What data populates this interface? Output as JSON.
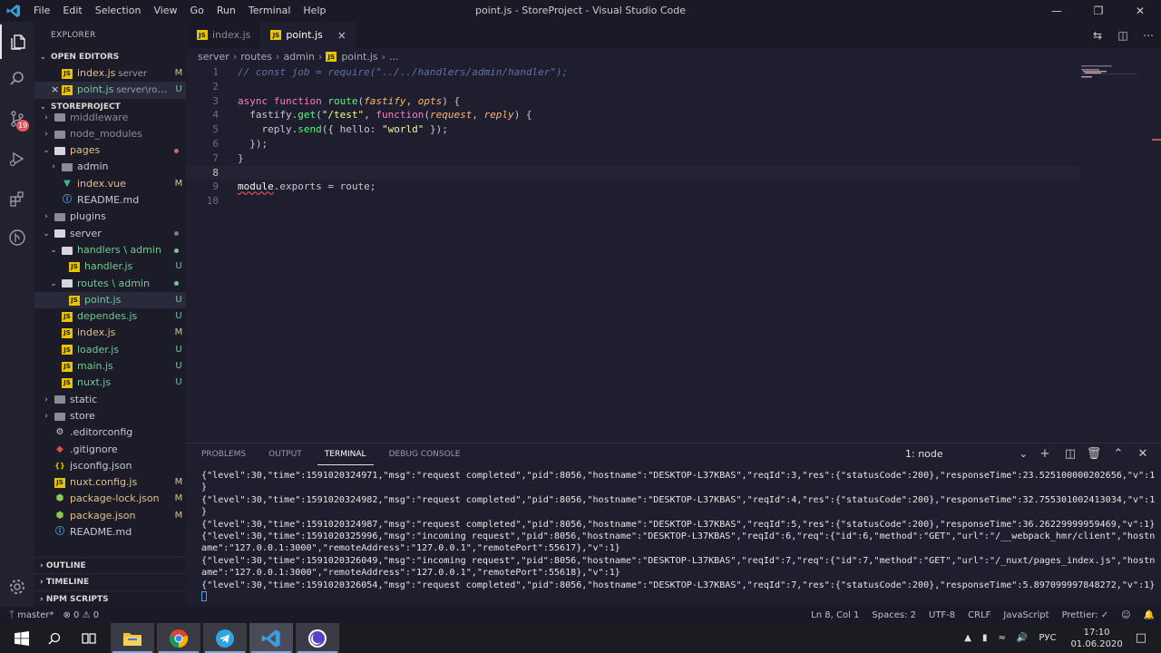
{
  "window": {
    "title": "point.js - StoreProject - Visual Studio Code",
    "menu": [
      "File",
      "Edit",
      "Selection",
      "View",
      "Go",
      "Run",
      "Terminal",
      "Help"
    ],
    "controls": [
      "minimize-icon",
      "restore-icon",
      "close-icon"
    ]
  },
  "activity_bar": {
    "items": [
      "files-icon",
      "search-icon",
      "source-control-icon",
      "run-debug-icon",
      "extensions-icon",
      "git-graph-icon"
    ],
    "source_control_badge": "19",
    "settings_icon": "gear-icon"
  },
  "sidebar": {
    "title": "EXPLORER",
    "open_editors": {
      "label": "OPEN EDITORS",
      "items": [
        {
          "name": "index.js",
          "path": "server",
          "status": "M",
          "close": ""
        },
        {
          "name": "point.js",
          "path": "server\\rou...",
          "status": "U",
          "close": "×"
        }
      ]
    },
    "project": {
      "label": "STOREPROJECT",
      "tree": [
        {
          "name": "middleware",
          "icon": "folder",
          "depth": 1,
          "arrow": "›",
          "status": "",
          "color": "dim"
        },
        {
          "name": "node_modules",
          "icon": "folder",
          "depth": 1,
          "arrow": "›",
          "status": "",
          "color": "dim"
        },
        {
          "name": "pages",
          "icon": "folder-open",
          "depth": 1,
          "arrow": "⌄",
          "status": "dot-mod",
          "color": "mod"
        },
        {
          "name": "admin",
          "icon": "folder",
          "depth": 2,
          "arrow": "›",
          "status": "",
          "color": "plain"
        },
        {
          "name": "index.vue",
          "icon": "vue",
          "depth": 2,
          "arrow": "",
          "status": "M",
          "color": "mod"
        },
        {
          "name": "README.md",
          "icon": "info",
          "depth": 2,
          "arrow": "",
          "status": "",
          "color": "plain"
        },
        {
          "name": "plugins",
          "icon": "folder",
          "depth": 1,
          "arrow": "›",
          "status": "",
          "color": "plain"
        },
        {
          "name": "server",
          "icon": "folder-open",
          "depth": 1,
          "arrow": "⌄",
          "status": "dot-grey",
          "color": "plain"
        },
        {
          "name": "handlers \\ admin",
          "icon": "folder-open",
          "depth": 2,
          "arrow": "⌄",
          "status": "dot-new",
          "color": "new"
        },
        {
          "name": "handler.js",
          "icon": "js",
          "depth": 3,
          "arrow": "",
          "status": "U",
          "color": "new"
        },
        {
          "name": "routes \\ admin",
          "icon": "folder-open",
          "depth": 2,
          "arrow": "⌄",
          "status": "dot-new",
          "color": "new"
        },
        {
          "name": "point.js",
          "icon": "js",
          "depth": 3,
          "arrow": "",
          "status": "U",
          "color": "new",
          "selected": true
        },
        {
          "name": "dependes.js",
          "icon": "js",
          "depth": 2,
          "arrow": "",
          "status": "U",
          "color": "new"
        },
        {
          "name": "index.js",
          "icon": "js",
          "depth": 2,
          "arrow": "",
          "status": "M",
          "color": "mod"
        },
        {
          "name": "loader.js",
          "icon": "js",
          "depth": 2,
          "arrow": "",
          "status": "U",
          "color": "new"
        },
        {
          "name": "main.js",
          "icon": "js",
          "depth": 2,
          "arrow": "",
          "status": "U",
          "color": "new"
        },
        {
          "name": "nuxt.js",
          "icon": "js",
          "depth": 2,
          "arrow": "",
          "status": "U",
          "color": "new"
        },
        {
          "name": "static",
          "icon": "folder",
          "depth": 1,
          "arrow": "›",
          "status": "",
          "color": "plain"
        },
        {
          "name": "store",
          "icon": "folder",
          "depth": 1,
          "arrow": "›",
          "status": "",
          "color": "plain"
        },
        {
          "name": ".editorconfig",
          "icon": "gear",
          "depth": 1,
          "arrow": "",
          "status": "",
          "color": "plain"
        },
        {
          "name": ".gitignore",
          "icon": "git",
          "depth": 1,
          "arrow": "",
          "status": "",
          "color": "plain"
        },
        {
          "name": "jsconfig.json",
          "icon": "json",
          "depth": 1,
          "arrow": "",
          "status": "",
          "color": "plain"
        },
        {
          "name": "nuxt.config.js",
          "icon": "js",
          "depth": 1,
          "arrow": "",
          "status": "M",
          "color": "mod"
        },
        {
          "name": "package-lock.json",
          "icon": "node",
          "depth": 1,
          "arrow": "",
          "status": "M",
          "color": "mod"
        },
        {
          "name": "package.json",
          "icon": "node",
          "depth": 1,
          "arrow": "",
          "status": "M",
          "color": "mod"
        },
        {
          "name": "README.md",
          "icon": "info",
          "depth": 1,
          "arrow": "",
          "status": "",
          "color": "plain"
        }
      ]
    },
    "outline": "OUTLINE",
    "timeline": "TIMELINE",
    "npm_scripts": "NPM SCRIPTS"
  },
  "editor": {
    "tabs": [
      {
        "label": "index.js",
        "active": false
      },
      {
        "label": "point.js",
        "active": true,
        "close": "×"
      }
    ],
    "breadcrumb": [
      "server",
      "routes",
      "admin",
      "point.js",
      "..."
    ],
    "lines": [
      {
        "n": "1",
        "text": "// const job = require(\"../../handlers/admin/handler\");"
      },
      {
        "n": "2",
        "text": ""
      },
      {
        "n": "3",
        "text": "async function route(fastify, opts) {"
      },
      {
        "n": "4",
        "text": "  fastify.get(\"/test\", function(request, reply) {"
      },
      {
        "n": "5",
        "text": "    reply.send({ hello: \"world\" });"
      },
      {
        "n": "6",
        "text": "  });"
      },
      {
        "n": "7",
        "text": "}"
      },
      {
        "n": "8",
        "text": ""
      },
      {
        "n": "9",
        "text": "module.exports = route;"
      },
      {
        "n": "10",
        "text": ""
      }
    ]
  },
  "panel": {
    "tabs": [
      "PROBLEMS",
      "OUTPUT",
      "TERMINAL",
      "DEBUG CONSOLE"
    ],
    "active_tab": "TERMINAL",
    "terminal_select": "1: node",
    "terminal_lines": [
      "{\"level\":30,\"time\":1591020324971,\"msg\":\"request completed\",\"pid\":8056,\"hostname\":\"DESKTOP-L37KBAS\",\"reqId\":3,\"res\":{\"statusCode\":200},\"responseTime\":23.525100000202656,\"v\":1",
      "}",
      "{\"level\":30,\"time\":1591020324982,\"msg\":\"request completed\",\"pid\":8056,\"hostname\":\"DESKTOP-L37KBAS\",\"reqId\":4,\"res\":{\"statusCode\":200},\"responseTime\":32.755301002413034,\"v\":1",
      "}",
      "{\"level\":30,\"time\":1591020324987,\"msg\":\"request completed\",\"pid\":8056,\"hostname\":\"DESKTOP-L37KBAS\",\"reqId\":5,\"res\":{\"statusCode\":200},\"responseTime\":36.26229999959469,\"v\":1}",
      "{\"level\":30,\"time\":1591020325996,\"msg\":\"incoming request\",\"pid\":8056,\"hostname\":\"DESKTOP-L37KBAS\",\"reqId\":6,\"req\":{\"id\":6,\"method\":\"GET\",\"url\":\"/__webpack_hmr/client\",\"hostn",
      "ame\":\"127.0.0.1:3000\",\"remoteAddress\":\"127.0.0.1\",\"remotePort\":55617},\"v\":1}",
      "{\"level\":30,\"time\":1591020326049,\"msg\":\"incoming request\",\"pid\":8056,\"hostname\":\"DESKTOP-L37KBAS\",\"reqId\":7,\"req\":{\"id\":7,\"method\":\"GET\",\"url\":\"/_nuxt/pages_index.js\",\"hostn",
      "ame\":\"127.0.0.1:3000\",\"remoteAddress\":\"127.0.0.1\",\"remotePort\":55618},\"v\":1}",
      "{\"level\":30,\"time\":1591020326054,\"msg\":\"request completed\",\"pid\":8056,\"hostname\":\"DESKTOP-L37KBAS\",\"reqId\":7,\"res\":{\"statusCode\":200},\"responseTime\":5.897099997848272,\"v\":1}"
    ]
  },
  "status_bar": {
    "branch": "master*",
    "errors": "0",
    "warnings": "0",
    "position": "Ln 8, Col 1",
    "spaces": "Spaces: 2",
    "encoding": "UTF-8",
    "eol": "CRLF",
    "language": "JavaScript",
    "prettier": "Prettier: ✓"
  },
  "taskbar": {
    "apps": [
      "windows-start-icon",
      "search-icon",
      "task-view-icon",
      "file-explorer-icon",
      "chrome-icon",
      "telegram-icon",
      "vscode-icon",
      "app-icon"
    ],
    "lang": "РУС",
    "time": "17:10",
    "date": "01.06.2020"
  },
  "colors": {
    "accent": "#007acc",
    "modified": "#e2c08d",
    "untracked": "#73c991",
    "keyword": "#ff79c6",
    "function": "#50fa7b",
    "string": "#f1fa8c",
    "param": "#ffb86c"
  }
}
